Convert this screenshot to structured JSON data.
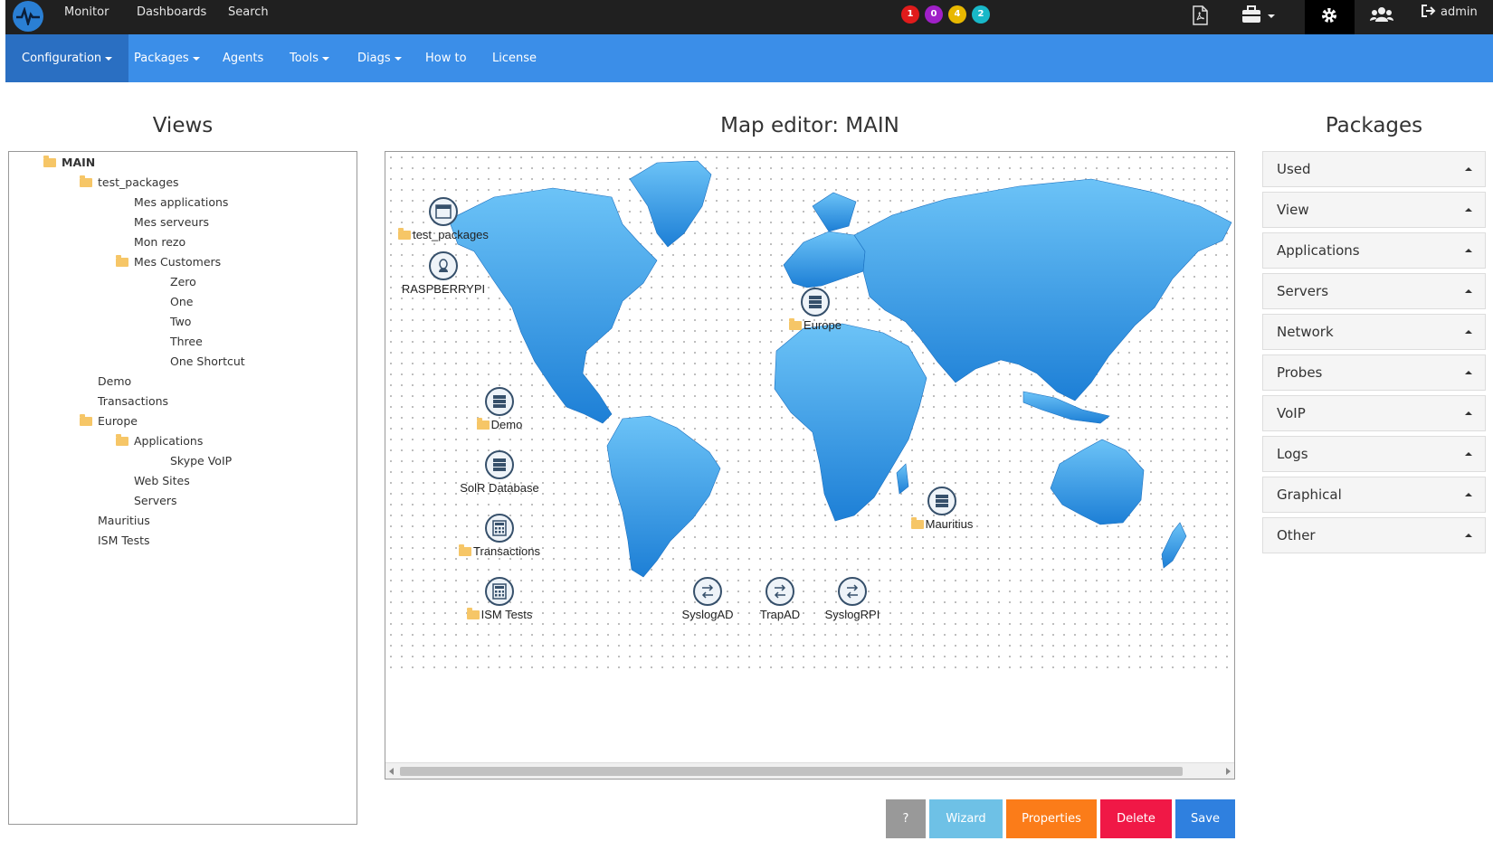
{
  "topnav": {
    "items": [
      {
        "label": "Monitor"
      },
      {
        "label": "Dashboards"
      },
      {
        "label": "Search"
      }
    ],
    "badges": [
      {
        "value": "1",
        "color": "#e01b1b"
      },
      {
        "value": "0",
        "color": "#a020c8"
      },
      {
        "value": "4",
        "color": "#e8b800"
      },
      {
        "value": "2",
        "color": "#18b8c8"
      }
    ],
    "icons": [
      "pdf-icon",
      "briefcase-icon",
      "gear-icon",
      "users-icon"
    ],
    "user_label": "admin"
  },
  "subnav": {
    "items": [
      {
        "label": "Configuration",
        "dropdown": true,
        "active": true
      },
      {
        "label": "Packages",
        "dropdown": true
      },
      {
        "label": "Agents",
        "dropdown": false
      },
      {
        "label": "Tools",
        "dropdown": true
      },
      {
        "label": "Diags",
        "dropdown": true
      },
      {
        "label": "How to",
        "dropdown": false
      },
      {
        "label": "License",
        "dropdown": false
      }
    ]
  },
  "views": {
    "title": "Views",
    "tree": [
      {
        "label": "MAIN",
        "folder": true,
        "bold": true,
        "level": 0
      },
      {
        "label": "test_packages",
        "folder": true,
        "level": 1
      },
      {
        "label": "Mes applications",
        "folder": false,
        "level": 2
      },
      {
        "label": "Mes serveurs",
        "folder": false,
        "level": 2
      },
      {
        "label": "Mon rezo",
        "folder": false,
        "level": 2
      },
      {
        "label": "Mes Customers",
        "folder": true,
        "level": 2
      },
      {
        "label": "Zero",
        "folder": false,
        "level": 3
      },
      {
        "label": "One",
        "folder": false,
        "level": 3
      },
      {
        "label": "Two",
        "folder": false,
        "level": 3
      },
      {
        "label": "Three",
        "folder": false,
        "level": 3
      },
      {
        "label": "One Shortcut",
        "folder": false,
        "level": 3
      },
      {
        "label": "Demo",
        "folder": false,
        "level": 1
      },
      {
        "label": "Transactions",
        "folder": false,
        "level": 1
      },
      {
        "label": "Europe",
        "folder": true,
        "level": 1
      },
      {
        "label": "Applications",
        "folder": true,
        "level": 2
      },
      {
        "label": "Skype VoIP",
        "folder": false,
        "level": 3
      },
      {
        "label": "Web Sites",
        "folder": false,
        "level": 2
      },
      {
        "label": "Servers",
        "folder": false,
        "level": 2
      },
      {
        "label": "Mauritius",
        "folder": false,
        "level": 1
      },
      {
        "label": "ISM Tests",
        "folder": false,
        "level": 1
      }
    ]
  },
  "map": {
    "title": "Map editor: MAIN",
    "nodes": [
      {
        "label": "test_packages",
        "icon": "window-icon",
        "folder": true
      },
      {
        "label": "RASPBERRYPI",
        "icon": "linux-icon",
        "folder": false
      },
      {
        "label": "Europe",
        "icon": "server-icon",
        "folder": true
      },
      {
        "label": "Demo",
        "icon": "server-icon",
        "folder": true
      },
      {
        "label": "SolR Database",
        "icon": "server-icon",
        "folder": false
      },
      {
        "label": "Transactions",
        "icon": "calculator-icon",
        "folder": true
      },
      {
        "label": "ISM Tests",
        "icon": "calculator-icon",
        "folder": true
      },
      {
        "label": "SyslogAD",
        "icon": "network-icon",
        "folder": false
      },
      {
        "label": "TrapAD",
        "icon": "network-icon",
        "folder": false
      },
      {
        "label": "SyslogRPI",
        "icon": "network-icon",
        "folder": false
      },
      {
        "label": "Mauritius",
        "icon": "server-icon",
        "folder": true
      }
    ]
  },
  "packages": {
    "title": "Packages",
    "items": [
      {
        "label": "Used"
      },
      {
        "label": "View"
      },
      {
        "label": "Applications"
      },
      {
        "label": "Servers"
      },
      {
        "label": "Network"
      },
      {
        "label": "Probes"
      },
      {
        "label": "VoIP"
      },
      {
        "label": "Logs"
      },
      {
        "label": "Graphical"
      },
      {
        "label": "Other"
      }
    ]
  },
  "buttons": [
    {
      "label": "?",
      "color": "#999999"
    },
    {
      "label": "Wizard",
      "color": "#6ec1e6"
    },
    {
      "label": "Properties",
      "color": "#fb7c19"
    },
    {
      "label": "Delete",
      "color": "#f01846"
    },
    {
      "label": "Save",
      "color": "#2f80df"
    }
  ]
}
